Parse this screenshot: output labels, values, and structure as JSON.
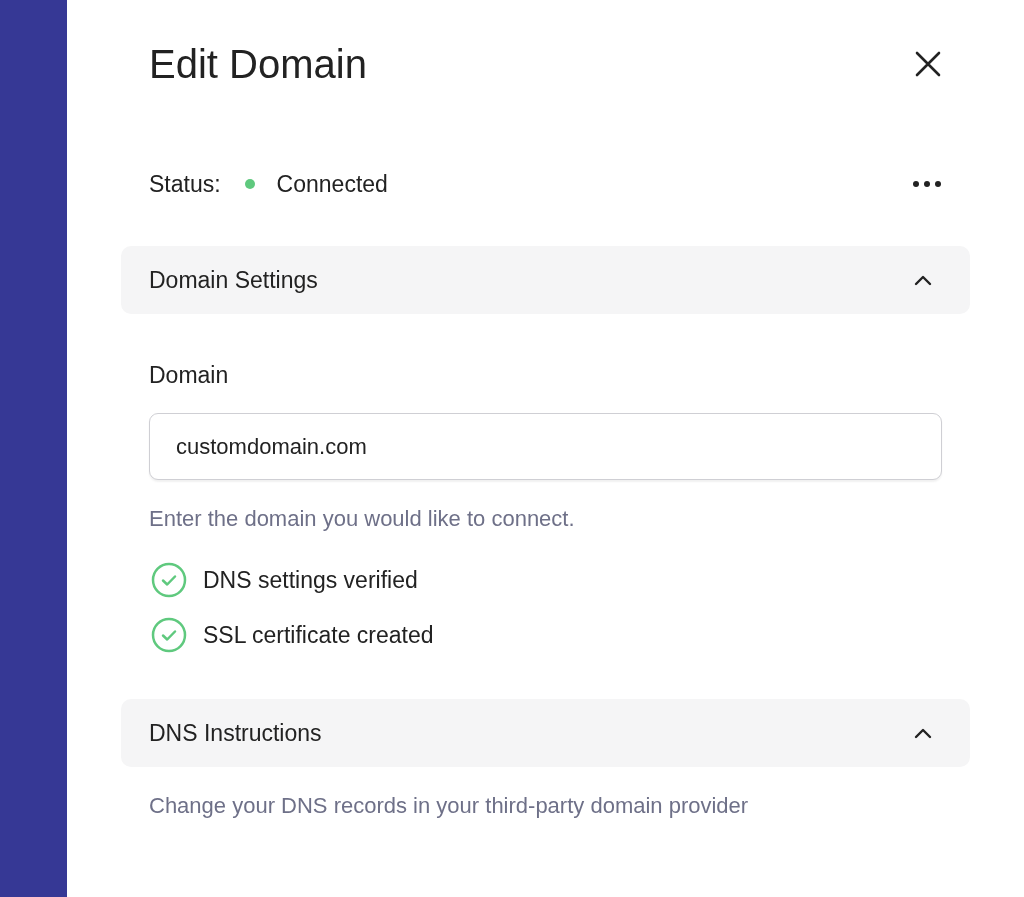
{
  "title": "Edit Domain",
  "status": {
    "label": "Status:",
    "value": "Connected",
    "color": "#5fc97e"
  },
  "sections": [
    {
      "kind": "settings",
      "title": "Domain Settings",
      "expanded": true,
      "field": {
        "label": "Domain",
        "value": "customdomain.com"
      },
      "help": "Enter the domain you would like to connect.",
      "checks": [
        {
          "label": "DNS settings verified",
          "done": true
        },
        {
          "label": "SSL certificate created",
          "done": true
        }
      ]
    },
    {
      "kind": "instructions",
      "title": "DNS Instructions",
      "expanded": true,
      "text": "Change your DNS records in your third-party domain provider"
    }
  ]
}
